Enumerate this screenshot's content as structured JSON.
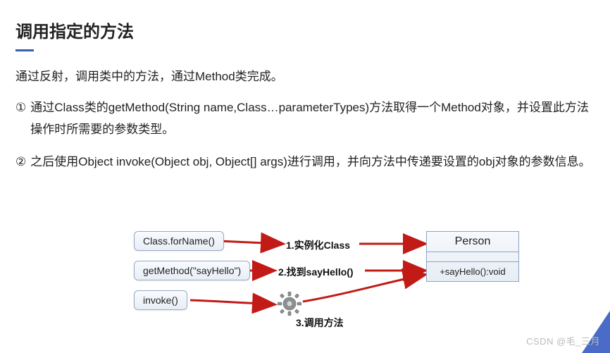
{
  "title": "调用指定的方法",
  "intro": "通过反射，调用类中的方法，通过Method类完成。",
  "steps": [
    {
      "num": "①",
      "text": "通过Class类的getMethod(String name,Class…parameterTypes)方法取得一个Method对象，并设置此方法操作时所需要的参数类型。"
    },
    {
      "num": "②",
      "text": "之后使用Object invoke(Object obj, Object[] args)进行调用，并向方法中传递要设置的obj对象的参数信息。"
    }
  ],
  "diagram": {
    "boxes": {
      "forName": "Class.forName()",
      "getMethod": "getMethod(\"sayHello\")",
      "invoke": "invoke()"
    },
    "labels": {
      "l1": "1.实例化Class",
      "l2": "2.找到sayHello()",
      "l3": "3.调用方法"
    },
    "uml": {
      "name": "Person",
      "method": "+sayHello():void"
    }
  },
  "watermark": "CSDN @毛_三月"
}
